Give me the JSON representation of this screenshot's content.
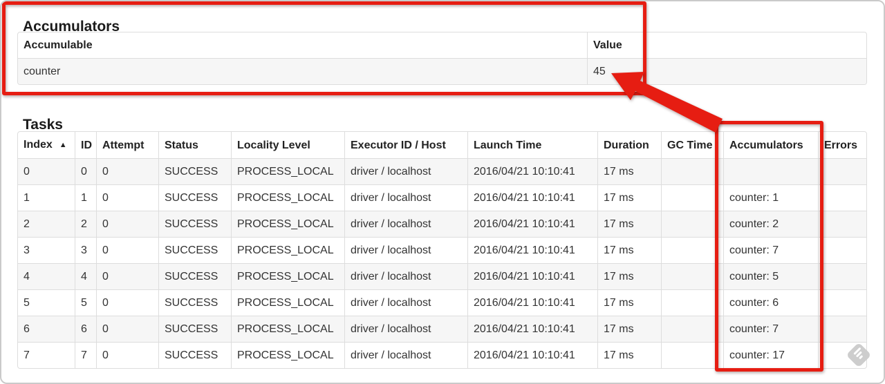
{
  "annotation": {
    "color": "#e61d12",
    "arrow_points_to": "45"
  },
  "accumulators_section": {
    "title": "Accumulators",
    "table": {
      "headers": [
        "Accumulable",
        "Value"
      ],
      "column_keys": [
        "accumulable",
        "value"
      ],
      "rows": [
        [
          "counter",
          "45"
        ]
      ]
    }
  },
  "tasks_section": {
    "title": "Tasks",
    "table": {
      "headers": [
        "Index",
        "ID",
        "Attempt",
        "Status",
        "Locality Level",
        "Executor ID / Host",
        "Launch Time",
        "Duration",
        "GC Time",
        "Accumulators",
        "Errors"
      ],
      "column_keys": [
        "index",
        "id",
        "attempt",
        "status",
        "locality-level",
        "executor-id-host",
        "launch-time",
        "duration",
        "gc-time",
        "accumulators",
        "errors"
      ],
      "sort_icon": "▲",
      "rows": [
        [
          "0",
          "0",
          "0",
          "SUCCESS",
          "PROCESS_LOCAL",
          "driver / localhost",
          "2016/04/21 10:10:41",
          "17 ms",
          "",
          "",
          ""
        ],
        [
          "1",
          "1",
          "0",
          "SUCCESS",
          "PROCESS_LOCAL",
          "driver / localhost",
          "2016/04/21 10:10:41",
          "17 ms",
          "",
          "counter: 1",
          ""
        ],
        [
          "2",
          "2",
          "0",
          "SUCCESS",
          "PROCESS_LOCAL",
          "driver / localhost",
          "2016/04/21 10:10:41",
          "17 ms",
          "",
          "counter: 2",
          ""
        ],
        [
          "3",
          "3",
          "0",
          "SUCCESS",
          "PROCESS_LOCAL",
          "driver / localhost",
          "2016/04/21 10:10:41",
          "17 ms",
          "",
          "counter: 7",
          ""
        ],
        [
          "4",
          "4",
          "0",
          "SUCCESS",
          "PROCESS_LOCAL",
          "driver / localhost",
          "2016/04/21 10:10:41",
          "17 ms",
          "",
          "counter: 5",
          ""
        ],
        [
          "5",
          "5",
          "0",
          "SUCCESS",
          "PROCESS_LOCAL",
          "driver / localhost",
          "2016/04/21 10:10:41",
          "17 ms",
          "",
          "counter: 6",
          ""
        ],
        [
          "6",
          "6",
          "0",
          "SUCCESS",
          "PROCESS_LOCAL",
          "driver / localhost",
          "2016/04/21 10:10:41",
          "17 ms",
          "",
          "counter: 7",
          ""
        ],
        [
          "7",
          "7",
          "0",
          "SUCCESS",
          "PROCESS_LOCAL",
          "driver / localhost",
          "2016/04/21 10:10:41",
          "17 ms",
          "",
          "counter: 17",
          ""
        ]
      ]
    }
  },
  "watermark_icon": "skitch-pen-diamond"
}
